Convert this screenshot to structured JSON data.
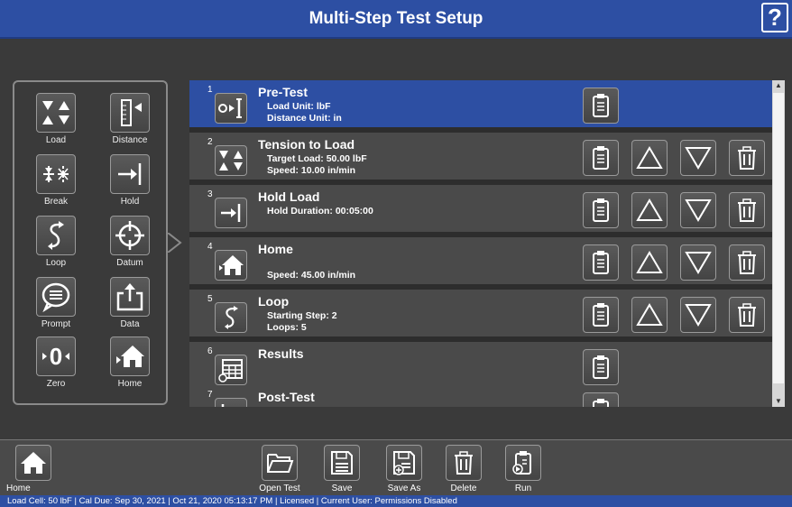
{
  "header": {
    "title": "Multi-Step Test Setup",
    "help_label": "?"
  },
  "toolbox": {
    "items": [
      {
        "label": "Load",
        "icon": "load-icon"
      },
      {
        "label": "Distance",
        "icon": "distance-icon"
      },
      {
        "label": "Break",
        "icon": "break-icon"
      },
      {
        "label": "Hold",
        "icon": "hold-icon"
      },
      {
        "label": "Loop",
        "icon": "loop-icon"
      },
      {
        "label": "Datum",
        "icon": "datum-icon"
      },
      {
        "label": "Prompt",
        "icon": "prompt-icon"
      },
      {
        "label": "Data",
        "icon": "data-icon"
      },
      {
        "label": "Zero",
        "icon": "zero-icon"
      },
      {
        "label": "Home",
        "icon": "home-icon"
      }
    ]
  },
  "steps": [
    {
      "number": "1",
      "title": "Pre-Test",
      "lines": [
        "Load Unit: lbF",
        "Distance Unit: in"
      ],
      "icon": "pretest-icon",
      "selected": true
    },
    {
      "number": "2",
      "title": "Tension to Load",
      "lines": [
        "Target Load: 50.00 lbF",
        "Speed: 10.00 in/min"
      ],
      "icon": "load-icon"
    },
    {
      "number": "3",
      "title": "Hold Load",
      "lines": [
        "Hold Duration: 00:05:00"
      ],
      "icon": "hold-icon"
    },
    {
      "number": "4",
      "title": "Home",
      "lines": [
        "",
        "Speed: 45.00 in/min"
      ],
      "icon": "home-icon"
    },
    {
      "number": "5",
      "title": "Loop",
      "lines": [
        "Starting Step: 2",
        "Loops: 5"
      ],
      "icon": "loop-icon"
    },
    {
      "number": "6",
      "title": "Results",
      "lines": [],
      "icon": "results-icon"
    },
    {
      "number": "7",
      "title": "Post-Test",
      "lines": [],
      "icon": "posttest-icon"
    }
  ],
  "bottom": {
    "home_label": "Home",
    "open_label": "Open Test",
    "save_label": "Save",
    "saveas_label": "Save As",
    "delete_label": "Delete",
    "run_label": "Run"
  },
  "status": {
    "text": "Load Cell: 50 lbF   |   Cal Due: Sep 30, 2021   |   Oct 21, 2020 05:13:17 PM   |   Licensed   |   Current User: Permissions Disabled"
  },
  "colors": {
    "accent": "#2d4fa3",
    "panel": "#4a4a4a",
    "background": "#3a3a3a"
  }
}
